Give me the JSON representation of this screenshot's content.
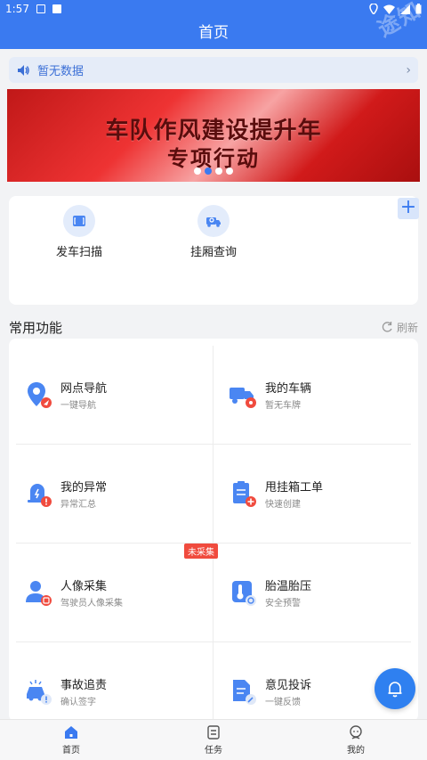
{
  "status_bar": {
    "time": "1:57"
  },
  "watermark": "途知",
  "nav": {
    "title": "首页"
  },
  "notice": {
    "text": "暂无数据"
  },
  "banner": {
    "line1": "车队作风建设提升年",
    "line2": "专项行动",
    "slide_count": 4,
    "active_index": 1
  },
  "quick_actions": [
    {
      "label": "发车扫描",
      "icon": "scan-icon"
    },
    {
      "label": "挂厢查询",
      "icon": "truck-search-icon"
    }
  ],
  "section": {
    "title": "常用功能",
    "refresh": "刷新"
  },
  "functions": [
    {
      "title": "网点导航",
      "sub": "一键导航",
      "icon": "location-nav-icon"
    },
    {
      "title": "我的车辆",
      "sub": "暂无车牌",
      "icon": "truck-icon"
    },
    {
      "title": "我的异常",
      "sub": "异常汇总",
      "icon": "alert-icon"
    },
    {
      "title": "甩挂箱工单",
      "sub": "快速创建",
      "icon": "clipboard-add-icon"
    },
    {
      "title": "人像采集",
      "sub": "驾驶员人像采集",
      "icon": "person-scan-icon"
    },
    {
      "title": "胎温胎压",
      "sub": "安全预警",
      "icon": "thermometer-icon"
    },
    {
      "title": "事故追责",
      "sub": "确认签字",
      "icon": "car-accident-icon"
    },
    {
      "title": "意见投诉",
      "sub": "一键反馈",
      "icon": "feedback-icon"
    }
  ],
  "tag": {
    "text": "未采集"
  },
  "tabs": [
    {
      "label": "首页",
      "icon": "home-icon"
    },
    {
      "label": "任务",
      "icon": "task-icon"
    },
    {
      "label": "我的",
      "icon": "profile-icon"
    }
  ],
  "colors": {
    "primary": "#3a7af0",
    "alert": "#f04b3e"
  }
}
